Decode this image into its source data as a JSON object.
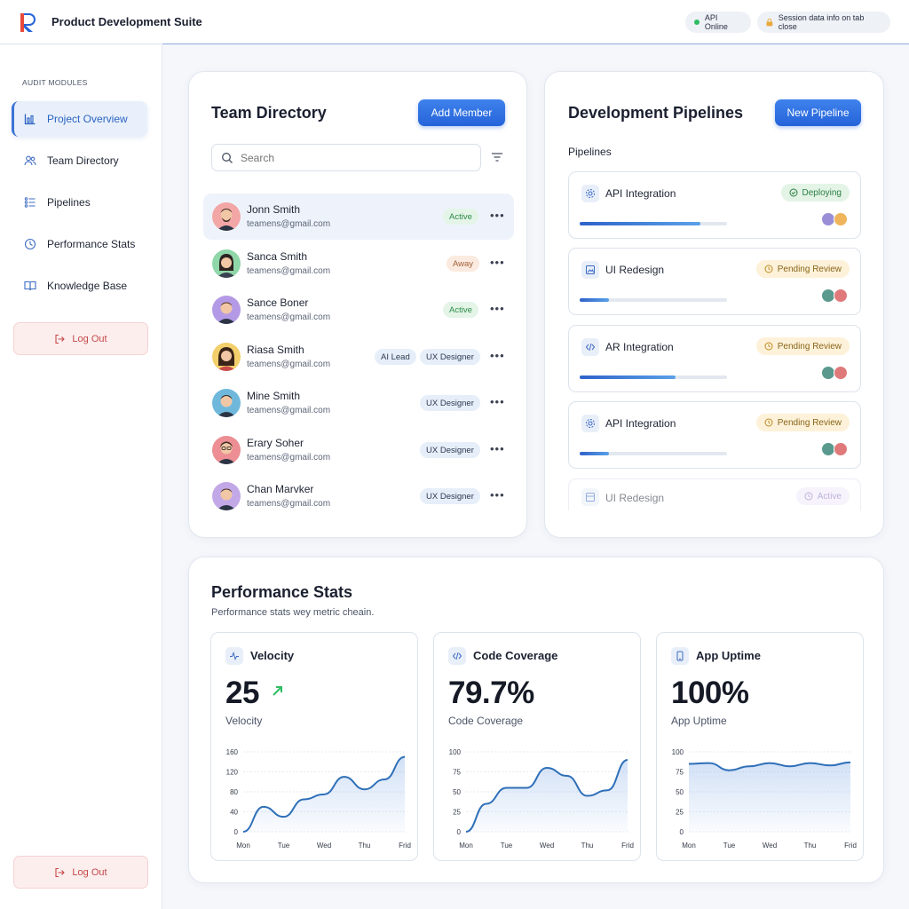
{
  "app": {
    "title": "Product Development Suite"
  },
  "status": {
    "api": "API Online",
    "session": "Session data info on tab close"
  },
  "sidebar": {
    "heading": "AUDIT MODULES",
    "items": [
      {
        "label": "Project Overview",
        "icon": "bar-chart-icon"
      },
      {
        "label": "Team Directory",
        "icon": "users-icon"
      },
      {
        "label": "Pipelines",
        "icon": "list-icon"
      },
      {
        "label": "Performance Stats",
        "icon": "gauge-icon"
      },
      {
        "label": "Knowledge Base",
        "icon": "book-icon"
      }
    ],
    "logout": "Log Out",
    "logout_bottom": "Log Out"
  },
  "team": {
    "title": "Team Directory",
    "add_button": "Add Member",
    "search_placeholder": "Search",
    "members": [
      {
        "name": "Jonn Smith",
        "email": "teamens@gmail.com",
        "tags": [
          "Active"
        ]
      },
      {
        "name": "Sanca Smith",
        "email": "teamens@gmail.com",
        "tags": [
          "Away"
        ]
      },
      {
        "name": "Sance Boner",
        "email": "teamens@gmail.com",
        "tags": [
          "Active"
        ]
      },
      {
        "name": "Riasa Smith",
        "email": "teamens@gmail.com",
        "tags": [
          "AI Lead",
          "UX Designer"
        ]
      },
      {
        "name": "Mine Smith",
        "email": "teamens@gmail.com",
        "tags": [
          "UX Designer"
        ]
      },
      {
        "name": "Erary Soher",
        "email": "teamens@gmail.com",
        "tags": [
          "UX Designer"
        ]
      },
      {
        "name": "Chan Marvker",
        "email": "teamens@gmail.com",
        "tags": [
          "UX Designer"
        ]
      }
    ]
  },
  "pipelines": {
    "title": "Development Pipelines",
    "new_button": "New Pipeline",
    "subheading": "Pipelines",
    "items": [
      {
        "name": "API Integration",
        "status": "Deploying",
        "progress": 0.82,
        "icon": "gear-icon"
      },
      {
        "name": "UI Redesign",
        "status": "Pending Review",
        "progress": 0.2,
        "icon": "image-icon"
      },
      {
        "name": "AR Integration",
        "status": "Pending Review",
        "progress": 0.65,
        "icon": "code-icon"
      },
      {
        "name": "API Integration",
        "status": "Pending Review",
        "progress": 0.2,
        "icon": "gear-icon"
      },
      {
        "name": "UI Redesign",
        "status": "Active",
        "progress": 0,
        "icon": "image-icon"
      }
    ]
  },
  "performance": {
    "title": "Performance Stats",
    "subtitle": "Performance stats wey metric cheain.",
    "stats": [
      {
        "title": "Velocity",
        "value": "25",
        "label": "Velocity",
        "icon": "pulse-icon"
      },
      {
        "title": "Code Coverage",
        "value": "79.7%",
        "label": "Code Coverage",
        "icon": "code-icon"
      },
      {
        "title": "App Uptime",
        "value": "100%",
        "label": "App Uptime",
        "icon": "phone-icon"
      }
    ]
  },
  "chart_data": [
    {
      "type": "area",
      "title": "Velocity",
      "categories": [
        "Mon",
        "Tue",
        "Wed",
        "Thu",
        "Frid"
      ],
      "ylim": [
        0,
        160
      ],
      "yticks": [
        0,
        40,
        80,
        120,
        160
      ],
      "x": [
        0,
        0.5,
        1,
        1.5,
        2,
        2.5,
        3,
        3.5,
        4
      ],
      "values": [
        0,
        50,
        30,
        65,
        75,
        110,
        85,
        105,
        150
      ]
    },
    {
      "type": "area",
      "title": "Code Coverage",
      "categories": [
        "Mon",
        "Tue",
        "Wed",
        "Thu",
        "Frid"
      ],
      "ylim": [
        0,
        100
      ],
      "yticks": [
        0,
        25,
        50,
        75,
        100
      ],
      "x": [
        0,
        0.5,
        1,
        1.5,
        2,
        2.5,
        3,
        3.5,
        4
      ],
      "values": [
        0,
        35,
        55,
        55,
        80,
        70,
        45,
        52,
        90
      ]
    },
    {
      "type": "area",
      "title": "App Uptime",
      "categories": [
        "Mon",
        "Tue",
        "Wed",
        "Thu",
        "Frid"
      ],
      "ylim": [
        0,
        100
      ],
      "yticks": [
        0,
        25,
        50,
        75,
        100
      ],
      "x": [
        0,
        0.5,
        1,
        1.5,
        2,
        2.5,
        3,
        3.5,
        4
      ],
      "values": [
        85,
        86,
        77,
        82,
        86,
        82,
        86,
        83,
        87
      ]
    }
  ],
  "colors": {
    "accent": "#2563d9",
    "line": "#2e6fb8",
    "active": "#2b8a47",
    "pending": "#8a6319",
    "danger": "#c44848"
  }
}
